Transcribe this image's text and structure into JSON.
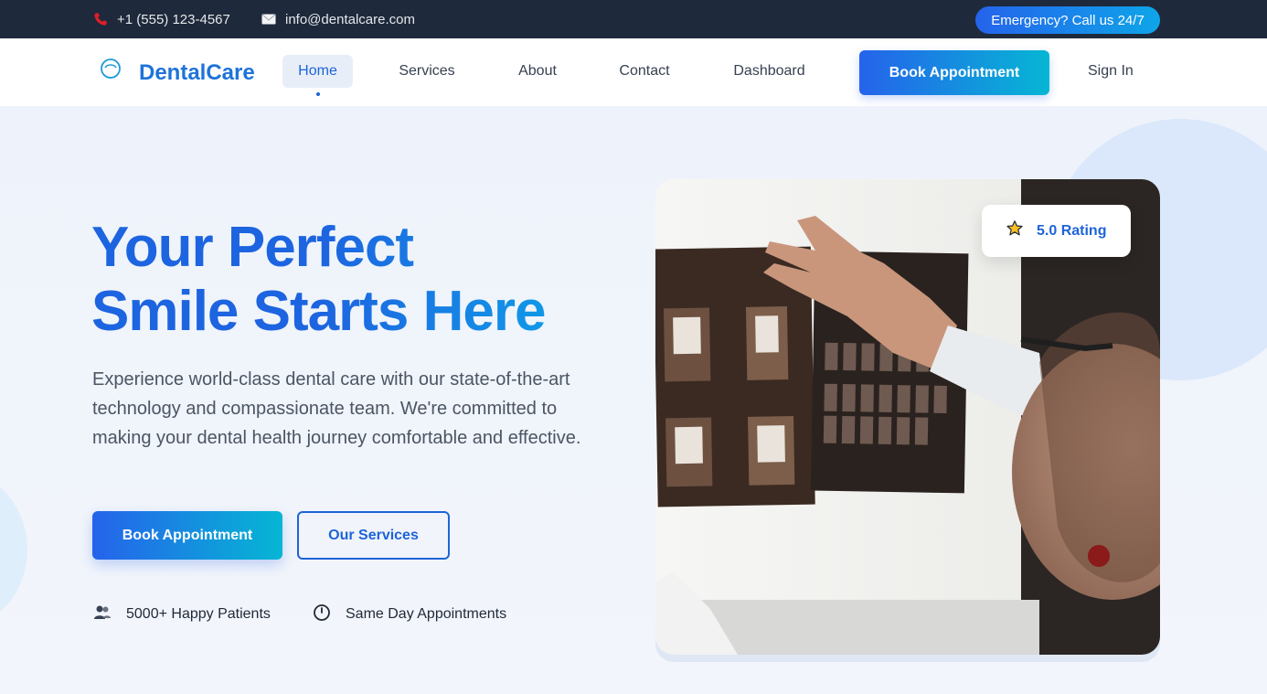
{
  "topbar": {
    "phone": "+1 (555) 123-4567",
    "email": "info@dentalcare.com",
    "emergency": "Emergency? Call us 24/7",
    "phone_icon": "phone-icon",
    "email_icon": "envelope-icon"
  },
  "nav": {
    "brand": "DentalCare",
    "links": [
      {
        "label": "Home",
        "active": true
      },
      {
        "label": "Services"
      },
      {
        "label": "About"
      },
      {
        "label": "Contact"
      },
      {
        "label": "Dashboard"
      }
    ],
    "cta": "Book Appointment",
    "signin": "Sign In"
  },
  "hero": {
    "headline_line1": "Your Perfect",
    "headline_line2": "Smile Starts Here",
    "lead": "Experience world-class dental care with our state-of-the-art technology and compassionate team. We're committed to making your dental health journey comfortable and effective.",
    "primary_button": "Book Appointment",
    "secondary_button": "Our Services",
    "stats": [
      {
        "icon": "users-icon",
        "label": "5000+ Happy Patients"
      },
      {
        "icon": "clock-icon",
        "label": "Same Day Appointments"
      }
    ],
    "rating": {
      "icon": "star-icon",
      "label": "5.0 Rating"
    }
  },
  "colors": {
    "topbar_bg": "#1e293b",
    "brand_blue": "#1d64d8",
    "accent_cyan": "#06b6d4",
    "page_bg": "#eef3fb"
  }
}
